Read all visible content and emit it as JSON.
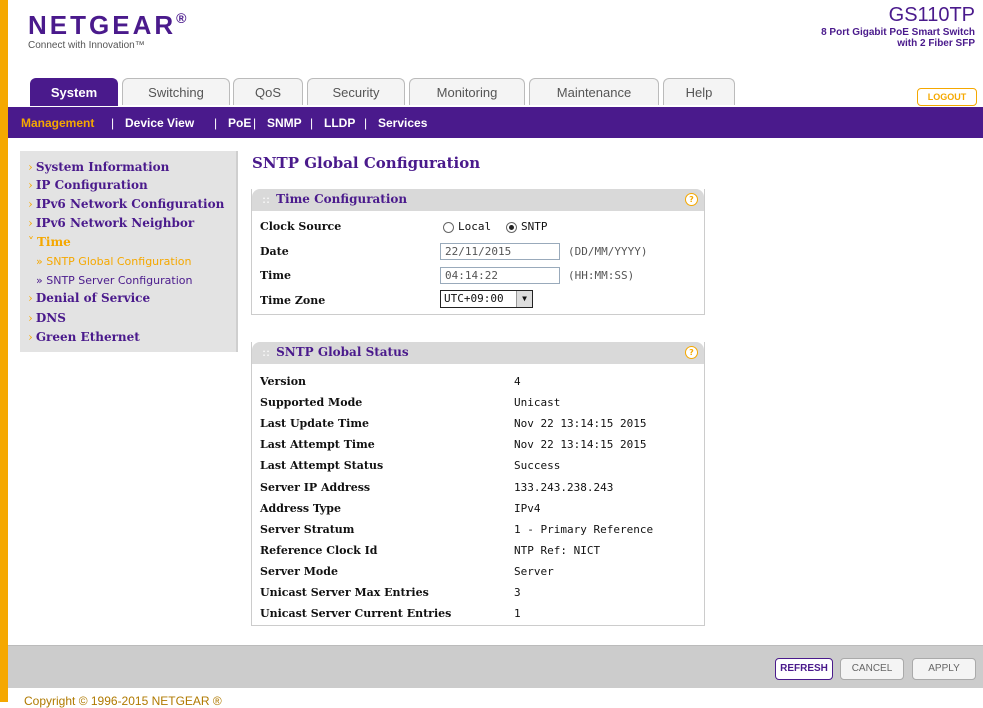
{
  "header": {
    "logo": "NETGEAR",
    "logo_registered": "®",
    "tagline": "Connect with Innovation™",
    "model": "GS110TP",
    "model_desc1": "8 Port Gigabit PoE Smart Switch",
    "model_desc2": "with 2 Fiber SFP",
    "logout": "LOGOUT"
  },
  "tabs": [
    "System",
    "Switching",
    "QoS",
    "Security",
    "Monitoring",
    "Maintenance",
    "Help"
  ],
  "subnav": [
    "Management",
    "Device View",
    "PoE",
    "SNMP",
    "LLDP",
    "Services"
  ],
  "sidebar": {
    "items": [
      "System Information",
      "IP Configuration",
      "IPv6 Network Configuration",
      "IPv6 Network Neighbor",
      "Time",
      "Denial of Service",
      "DNS",
      "Green Ethernet"
    ],
    "sub_items": [
      "SNTP Global Configuration",
      "SNTP Server Configuration"
    ]
  },
  "page_title": "SNTP Global Configuration",
  "time_config": {
    "title": "Time Configuration",
    "clock_source_label": "Clock Source",
    "clock_source_options": [
      "Local",
      "SNTP"
    ],
    "clock_source_selected": "SNTP",
    "date_label": "Date",
    "date_value": "22/11/2015",
    "date_hint": "(DD/MM/YYYY)",
    "time_label": "Time",
    "time_value": "04:14:22",
    "time_hint": "(HH:MM:SS)",
    "timezone_label": "Time Zone",
    "timezone_value": "UTC+09:00"
  },
  "status": {
    "title": "SNTP Global Status",
    "rows": [
      {
        "label": "Version",
        "value": "4"
      },
      {
        "label": "Supported Mode",
        "value": "Unicast"
      },
      {
        "label": "Last Update Time",
        "value": "Nov 22 13:14:15 2015"
      },
      {
        "label": "Last Attempt Time",
        "value": "Nov 22 13:14:15 2015"
      },
      {
        "label": "Last Attempt Status",
        "value": "Success"
      },
      {
        "label": "Server IP Address",
        "value": "133.243.238.243"
      },
      {
        "label": "Address Type",
        "value": "IPv4"
      },
      {
        "label": "Server Stratum",
        "value": "1 - Primary Reference"
      },
      {
        "label": "Reference Clock Id",
        "value": "NTP Ref: NICT"
      },
      {
        "label": "Server Mode",
        "value": "Server"
      },
      {
        "label": "Unicast Server Max Entries",
        "value": "3"
      },
      {
        "label": "Unicast Server Current Entries",
        "value": "1"
      }
    ]
  },
  "buttons": {
    "refresh": "REFRESH",
    "cancel": "CANCEL",
    "apply": "APPLY"
  },
  "copyright": "Copyright © 1996-2015 NETGEAR ®"
}
